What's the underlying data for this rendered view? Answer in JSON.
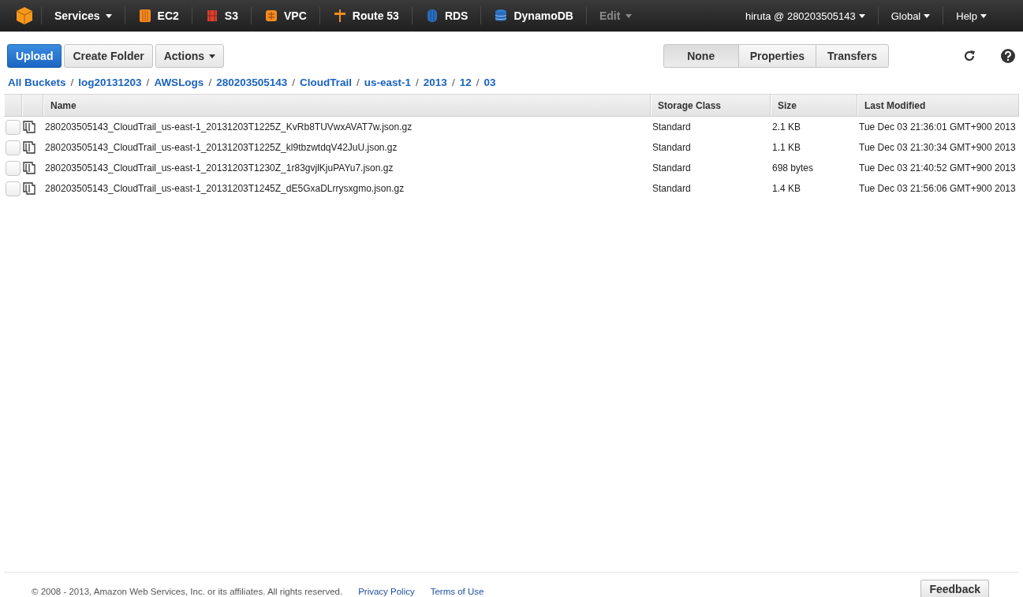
{
  "nav": {
    "services_label": "Services",
    "items": [
      {
        "label": "EC2",
        "kind": "ec2"
      },
      {
        "label": "S3",
        "kind": "s3"
      },
      {
        "label": "VPC",
        "kind": "vpc"
      },
      {
        "label": "Route 53",
        "kind": "route53"
      },
      {
        "label": "RDS",
        "kind": "rds"
      },
      {
        "label": "DynamoDB",
        "kind": "dynamodb"
      }
    ],
    "edit_label": "Edit",
    "edit_disabled": true,
    "account": "hiruta @ 280203505143",
    "region": "Global",
    "help": "Help"
  },
  "toolbar": {
    "upload": "Upload",
    "create_folder": "Create Folder",
    "actions": "Actions",
    "views": [
      {
        "label": "None",
        "selected": true
      },
      {
        "label": "Properties",
        "selected": false
      },
      {
        "label": "Transfers",
        "selected": false
      }
    ]
  },
  "breadcrumbs": [
    {
      "label": "All Buckets"
    },
    {
      "sep": "/",
      "label": "log20131203"
    },
    {
      "sep": "/",
      "label": "AWSLogs"
    },
    {
      "sep": "/",
      "label": "280203505143"
    },
    {
      "sep": "/",
      "label": "CloudTrail"
    },
    {
      "sep": "/",
      "label": "us-east-1"
    },
    {
      "sep": "/",
      "label": "2013"
    },
    {
      "sep": "/",
      "label": "12"
    },
    {
      "sep": "/",
      "label": "03"
    }
  ],
  "table": {
    "columns": [
      "Name",
      "Storage Class",
      "Size",
      "Last Modified"
    ],
    "rows": [
      {
        "checked": false,
        "name": "280203505143_CloudTrail_us-east-1_20131203T1225Z_KvRb8TUVwxAVAT7w.json.gz",
        "storage_class": "Standard",
        "size": "2.1 KB",
        "last_modified": "Tue Dec 03 21:36:01 GMT+900 2013"
      },
      {
        "checked": false,
        "name": "280203505143_CloudTrail_us-east-1_20131203T1225Z_kl9tbzwtdqV42JuU.json.gz",
        "storage_class": "Standard",
        "size": "1.1 KB",
        "last_modified": "Tue Dec 03 21:30:34 GMT+900 2013"
      },
      {
        "checked": false,
        "name": "280203505143_CloudTrail_us-east-1_20131203T1230Z_1r83gvjlKjuPAYu7.json.gz",
        "storage_class": "Standard",
        "size": "698 bytes",
        "last_modified": "Tue Dec 03 21:40:52 GMT+900 2013"
      },
      {
        "checked": false,
        "name": "280203505143_CloudTrail_us-east-1_20131203T1245Z_dE5GxaDLrrysxgmo.json.gz",
        "storage_class": "Standard",
        "size": "1.4 KB",
        "last_modified": "Tue Dec 03 21:56:06 GMT+900 2013"
      }
    ]
  },
  "footer": {
    "copyright": "© 2008 - 2013, Amazon Web Services, Inc. or its affiliates. All rights reserved.",
    "links": [
      "Privacy Policy",
      "Terms of Use"
    ],
    "feedback": "Feedback"
  }
}
